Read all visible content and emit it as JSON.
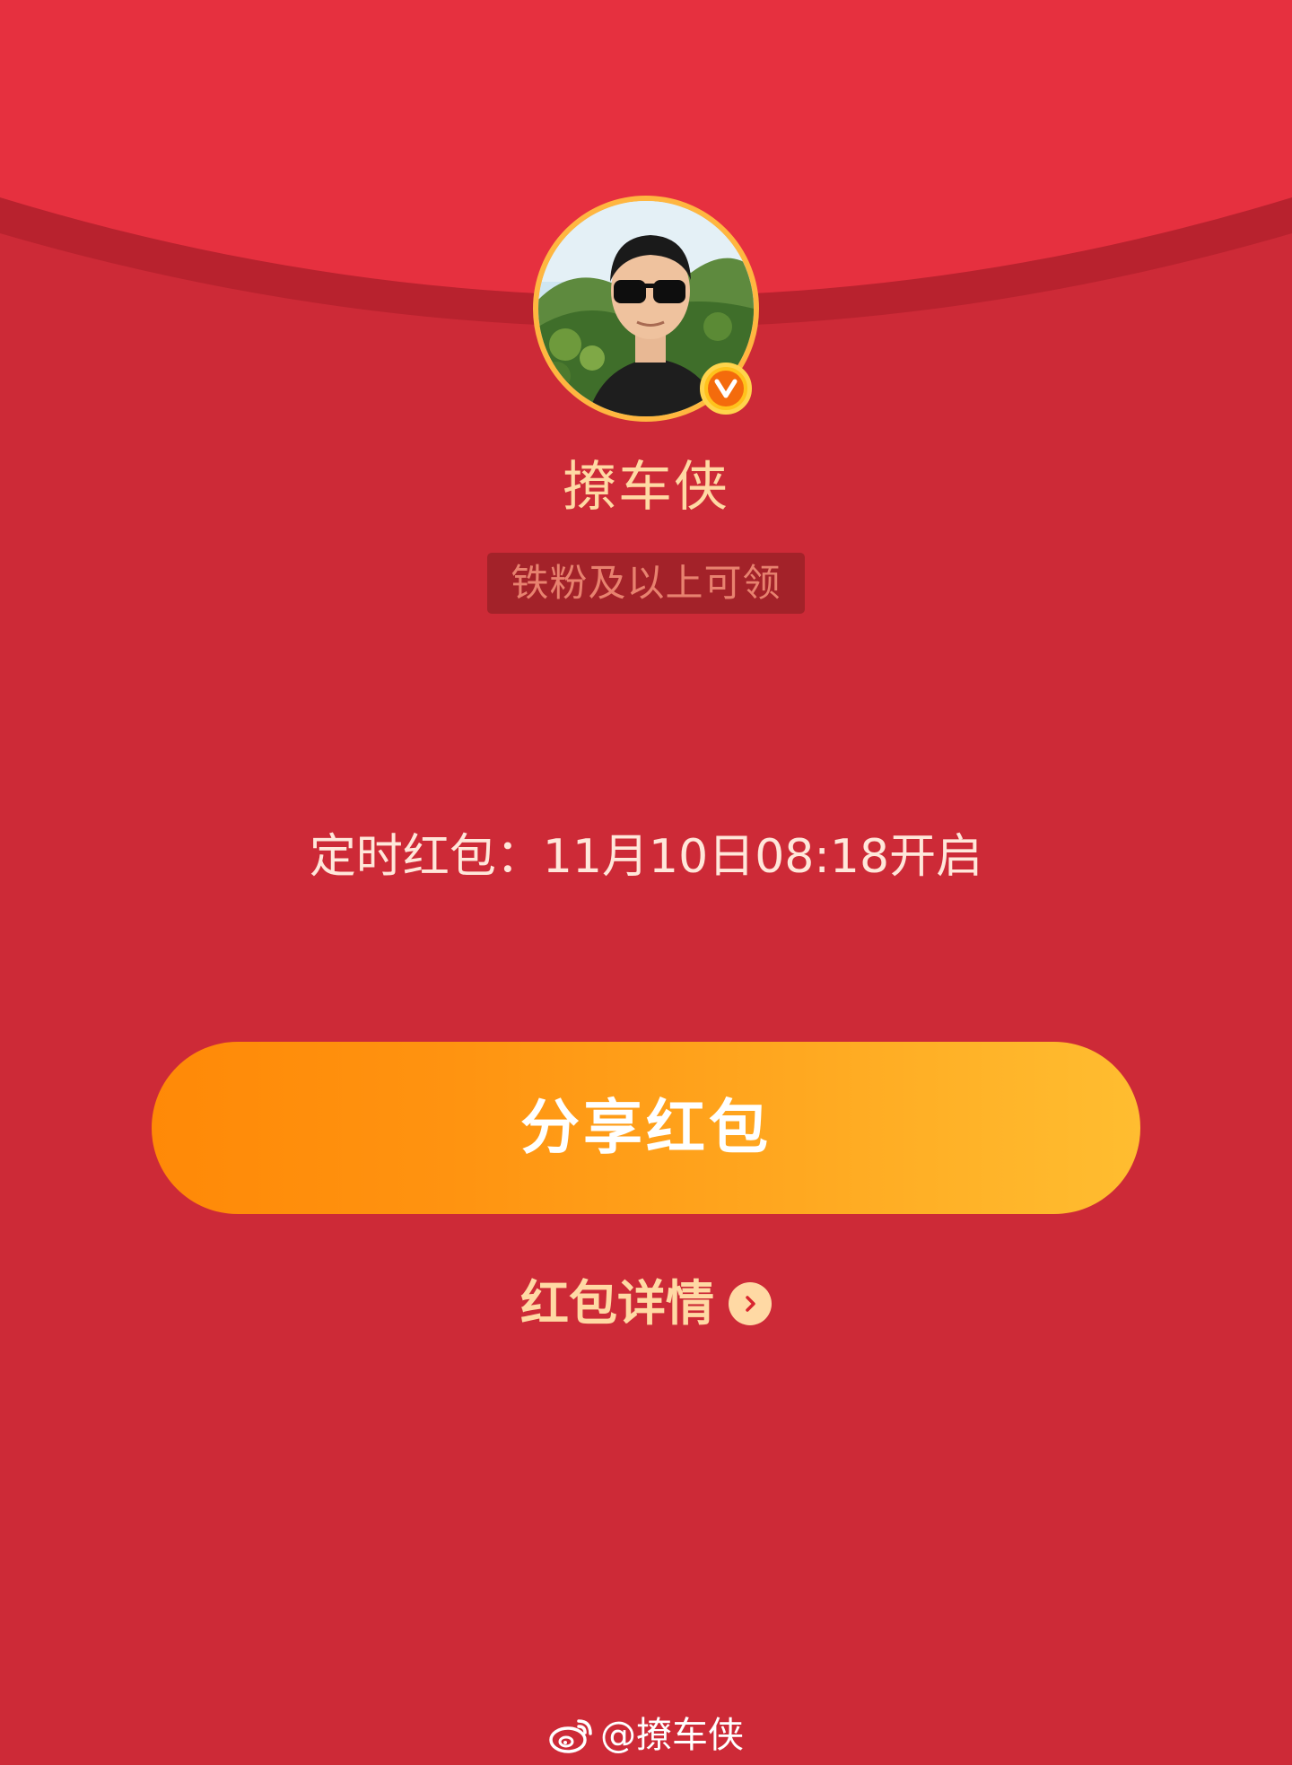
{
  "envelope": {
    "colors": {
      "background": "#CD2A37",
      "flap": "#E6303F",
      "accent": "#FFB640",
      "button_start": "#FF8907",
      "button_end": "#FFBD30"
    }
  },
  "sender": {
    "name": "撩车侠",
    "verified_icon": "verified-v-icon"
  },
  "eligibility": {
    "label": "铁粉及以上可领"
  },
  "timer": {
    "text": "定时红包：11月10日08:18开启"
  },
  "actions": {
    "share_label": "分享红包",
    "details_label": "红包详情",
    "details_icon": "chevron-right-icon"
  },
  "watermark": {
    "icon": "weibo-logo-icon",
    "text": "@撩车侠"
  }
}
